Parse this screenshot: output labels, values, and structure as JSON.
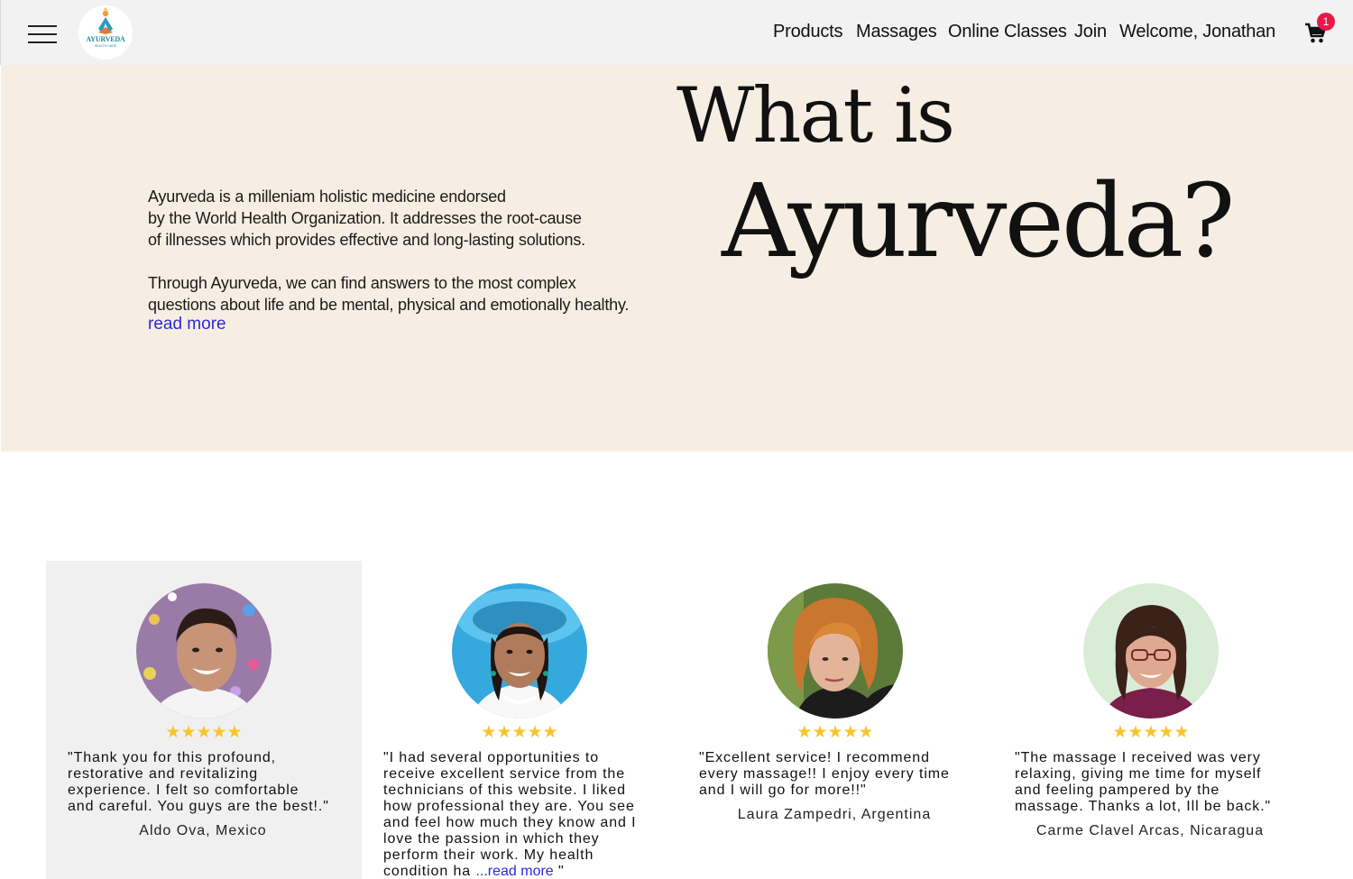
{
  "header": {
    "logo_text": "AYURVEDA",
    "logo_subtext": "HEALTH CARE",
    "nav": [
      "Products",
      "Massages",
      "Online Classes",
      "Join",
      "Welcome, Jonathan"
    ],
    "cart_count": "1"
  },
  "hero": {
    "title_line1": "What is",
    "title_line2": "Ayurveda?",
    "paragraph1": [
      "Ayurveda is a milleniam holistic medicine endorsed",
      "by the World Health Organization. It addresses the root-cause",
      "of illnesses which provides effective and long-lasting solutions."
    ],
    "paragraph2": [
      "Through Ayurveda, we can find answers to the most complex",
      "questions about life and be mental, physical and emotionally healthy."
    ],
    "read_more": "read more"
  },
  "testimonials": [
    {
      "stars": "★★★★★",
      "rating": 5,
      "quote_lines": [
        "\"Thank you for this profound,",
        "restorative and revitalizing",
        "experience. I felt so comfortable",
        "and careful. You guys are the best!.\""
      ],
      "author": "Aldo Ova, Mexico",
      "colors": {
        "bg": "#9a7aa6",
        "skin": "#c89478",
        "hair": "#2a1d18",
        "shirt": "#f4f4f4"
      }
    },
    {
      "stars": "★★★★★",
      "rating": 5,
      "quote_lines": [
        "\"I had several opportunities to",
        "receive excellent service from the",
        "technicians of this website. I liked",
        "how professional they are. You see",
        "and feel how much they know and I",
        "love the passion in which they",
        "perform their work. My health"
      ],
      "quote_last_prefix": "condition ha ",
      "quote_read_more": "...read more",
      "quote_last_suffix": " \"",
      "author": "",
      "colors": {
        "bg": "#35a9de",
        "skin": "#b07a5c",
        "hair": "#1e1410",
        "shirt": "#f8f8f8"
      }
    },
    {
      "stars": "★★★★★",
      "rating": 5,
      "quote_lines": [
        "\"Excellent service! I recommend",
        "every massage!! I enjoy every time",
        "and I will go for more!!\""
      ],
      "author": "Laura Zampedri, Argentina",
      "colors": {
        "bg": "#5c7a3a",
        "skin": "#e4b49a",
        "hair": "#c9762e",
        "shirt": "#1c1c1c"
      }
    },
    {
      "stars": "★★★★★",
      "rating": 5,
      "quote_lines": [
        "\"The massage I received was very",
        "relaxing, giving me time for myself",
        "and feeling pampered by the",
        "massage. Thanks a lot, Ill be back.\""
      ],
      "author": "Carme Clavel Arcas, Nicaragua",
      "colors": {
        "bg": "#d9ecd6",
        "skin": "#e0a890",
        "hair": "#3a2218",
        "shirt": "#7a1e4a"
      }
    }
  ],
  "colors": {
    "header_bg": "#f2f2f3",
    "hero_bg": "#f7eee3",
    "link": "#2a2ad6",
    "star": "#f7c52b",
    "badge": "#e8194a",
    "highlight_card": "#f0f0f0"
  }
}
